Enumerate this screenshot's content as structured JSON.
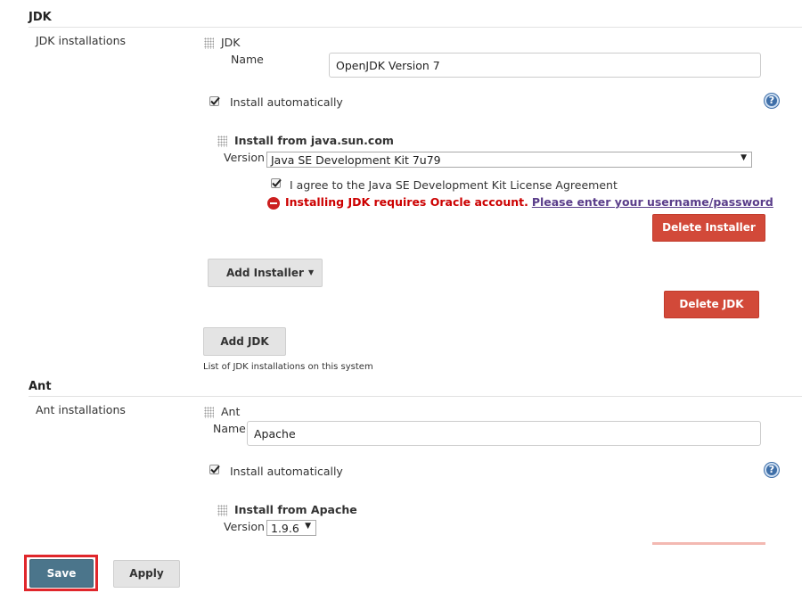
{
  "jdk_section": {
    "header": "JDK",
    "installations_label": "JDK installations",
    "item_title": "JDK",
    "name_label": "Name",
    "name_value": "OpenJDK Version 7",
    "install_auto_label": "Install automatically",
    "help": "?",
    "installer_title": "Install from java.sun.com",
    "version_label": "Version",
    "version_value": "Java SE Development Kit 7u79",
    "agree_label": "I agree to the Java SE Development Kit License Agreement",
    "error_text": "Installing JDK requires Oracle account.",
    "error_link": "Please enter your username/password",
    "delete_installer": "Delete Installer",
    "add_installer": "Add Installer",
    "delete_jdk": "Delete JDK",
    "add_jdk": "Add JDK",
    "hint": "List of JDK installations on this system"
  },
  "ant_section": {
    "header": "Ant",
    "installations_label": "Ant installations",
    "item_title": "Ant",
    "name_label": "Name",
    "name_value": "Apache",
    "install_auto_label": "Install automatically",
    "help": "?",
    "installer_title": "Install from Apache",
    "version_label": "Version",
    "version_value": "1.9.6"
  },
  "footer": {
    "save": "Save",
    "apply": "Apply"
  },
  "colors": {
    "danger": "#d24939",
    "save": "#4b758b",
    "focus_outline": "#e0262b"
  }
}
